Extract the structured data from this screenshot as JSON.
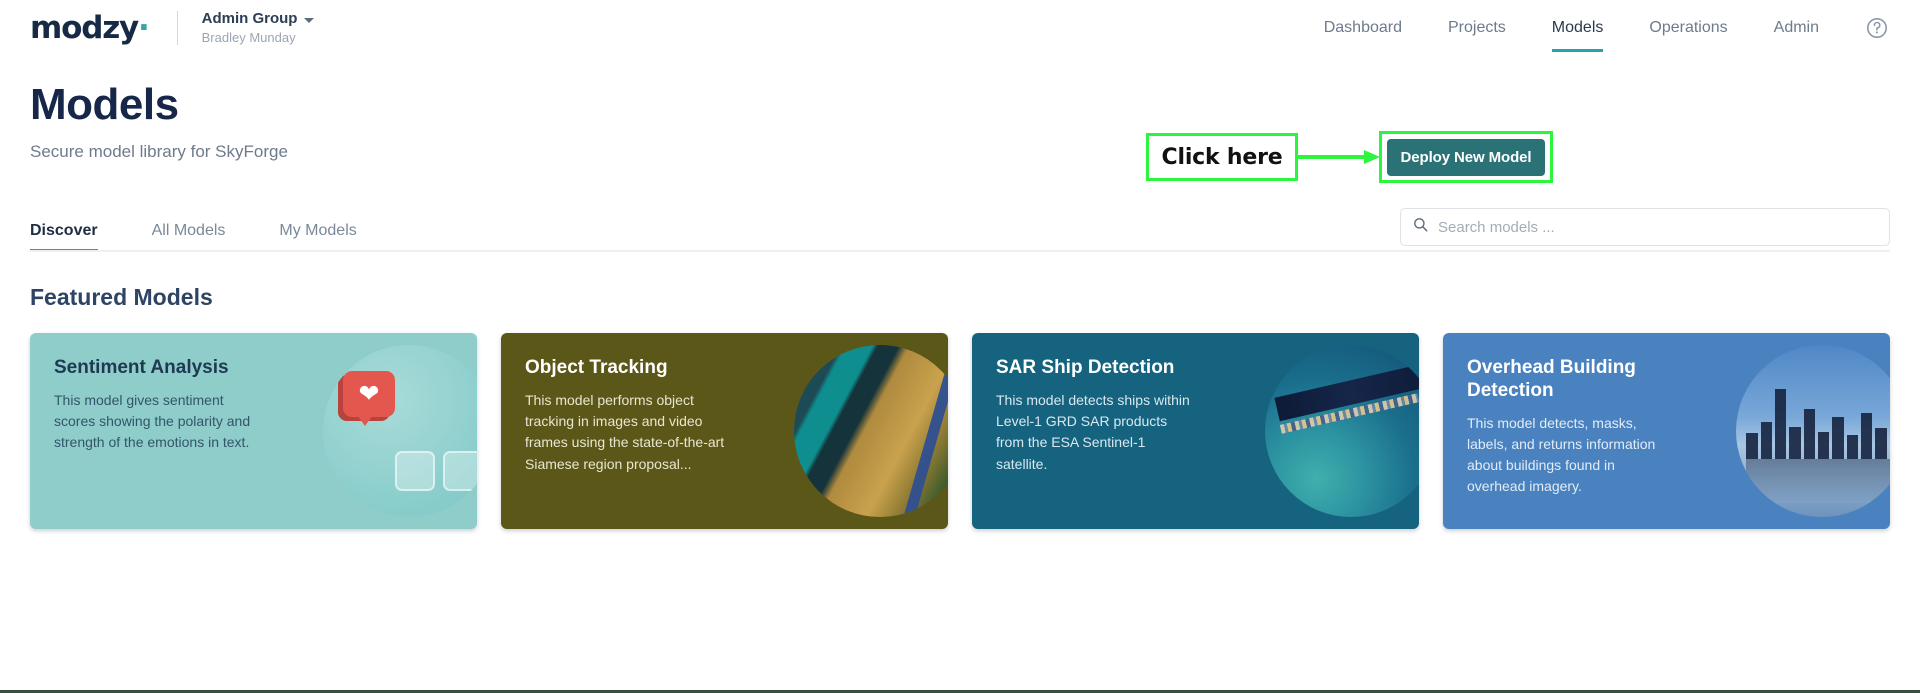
{
  "header": {
    "logo_text": "modzy",
    "logo_dot": "·",
    "user_group": "Admin Group",
    "user_name": "Bradley Munday",
    "nav_items": [
      {
        "label": "Dashboard",
        "active": false
      },
      {
        "label": "Projects",
        "active": false
      },
      {
        "label": "Models",
        "active": true
      },
      {
        "label": "Operations",
        "active": false
      },
      {
        "label": "Admin",
        "active": false
      }
    ],
    "help_icon": "question-circle-icon"
  },
  "page": {
    "title": "Models",
    "subtitle": "Secure model library for SkyForge"
  },
  "annotation": {
    "callout_text": "Click here",
    "box_color": "#2bf53c",
    "arrow_color": "#2bf53c"
  },
  "actions": {
    "deploy_label": "Deploy New Model",
    "deploy_color": "#2a7276"
  },
  "tabs": [
    {
      "label": "Discover",
      "active": true
    },
    {
      "label": "All Models",
      "active": false
    },
    {
      "label": "My Models",
      "active": false
    }
  ],
  "search": {
    "placeholder": "Search models ...",
    "value": "",
    "icon": "search-icon"
  },
  "featured": {
    "section_title": "Featured Models",
    "cards": [
      {
        "title": "Sentiment Analysis",
        "description": "This model gives sentiment scores showing the polarity and strength of the emotions in text.",
        "bg_color": "#8fcdcb",
        "art": "heart-like-badge-art"
      },
      {
        "title": "Object Tracking",
        "description": "This model performs object tracking in images and video frames using the state-of-the-art Siamese region proposal...",
        "bg_color": "#5b5719",
        "art": "aerial-terrain-art"
      },
      {
        "title": "SAR Ship Detection",
        "description": "This model detects ships within Level-1 GRD SAR products from the ESA Sentinel-1 satellite.",
        "bg_color": "#15637f",
        "art": "sar-satellite-art"
      },
      {
        "title": "Overhead Building Detection",
        "description": "This model detects, masks, labels, and returns information about buildings found in overhead imagery.",
        "bg_color": "#4a81bf",
        "art": "city-skyline-art"
      }
    ]
  }
}
